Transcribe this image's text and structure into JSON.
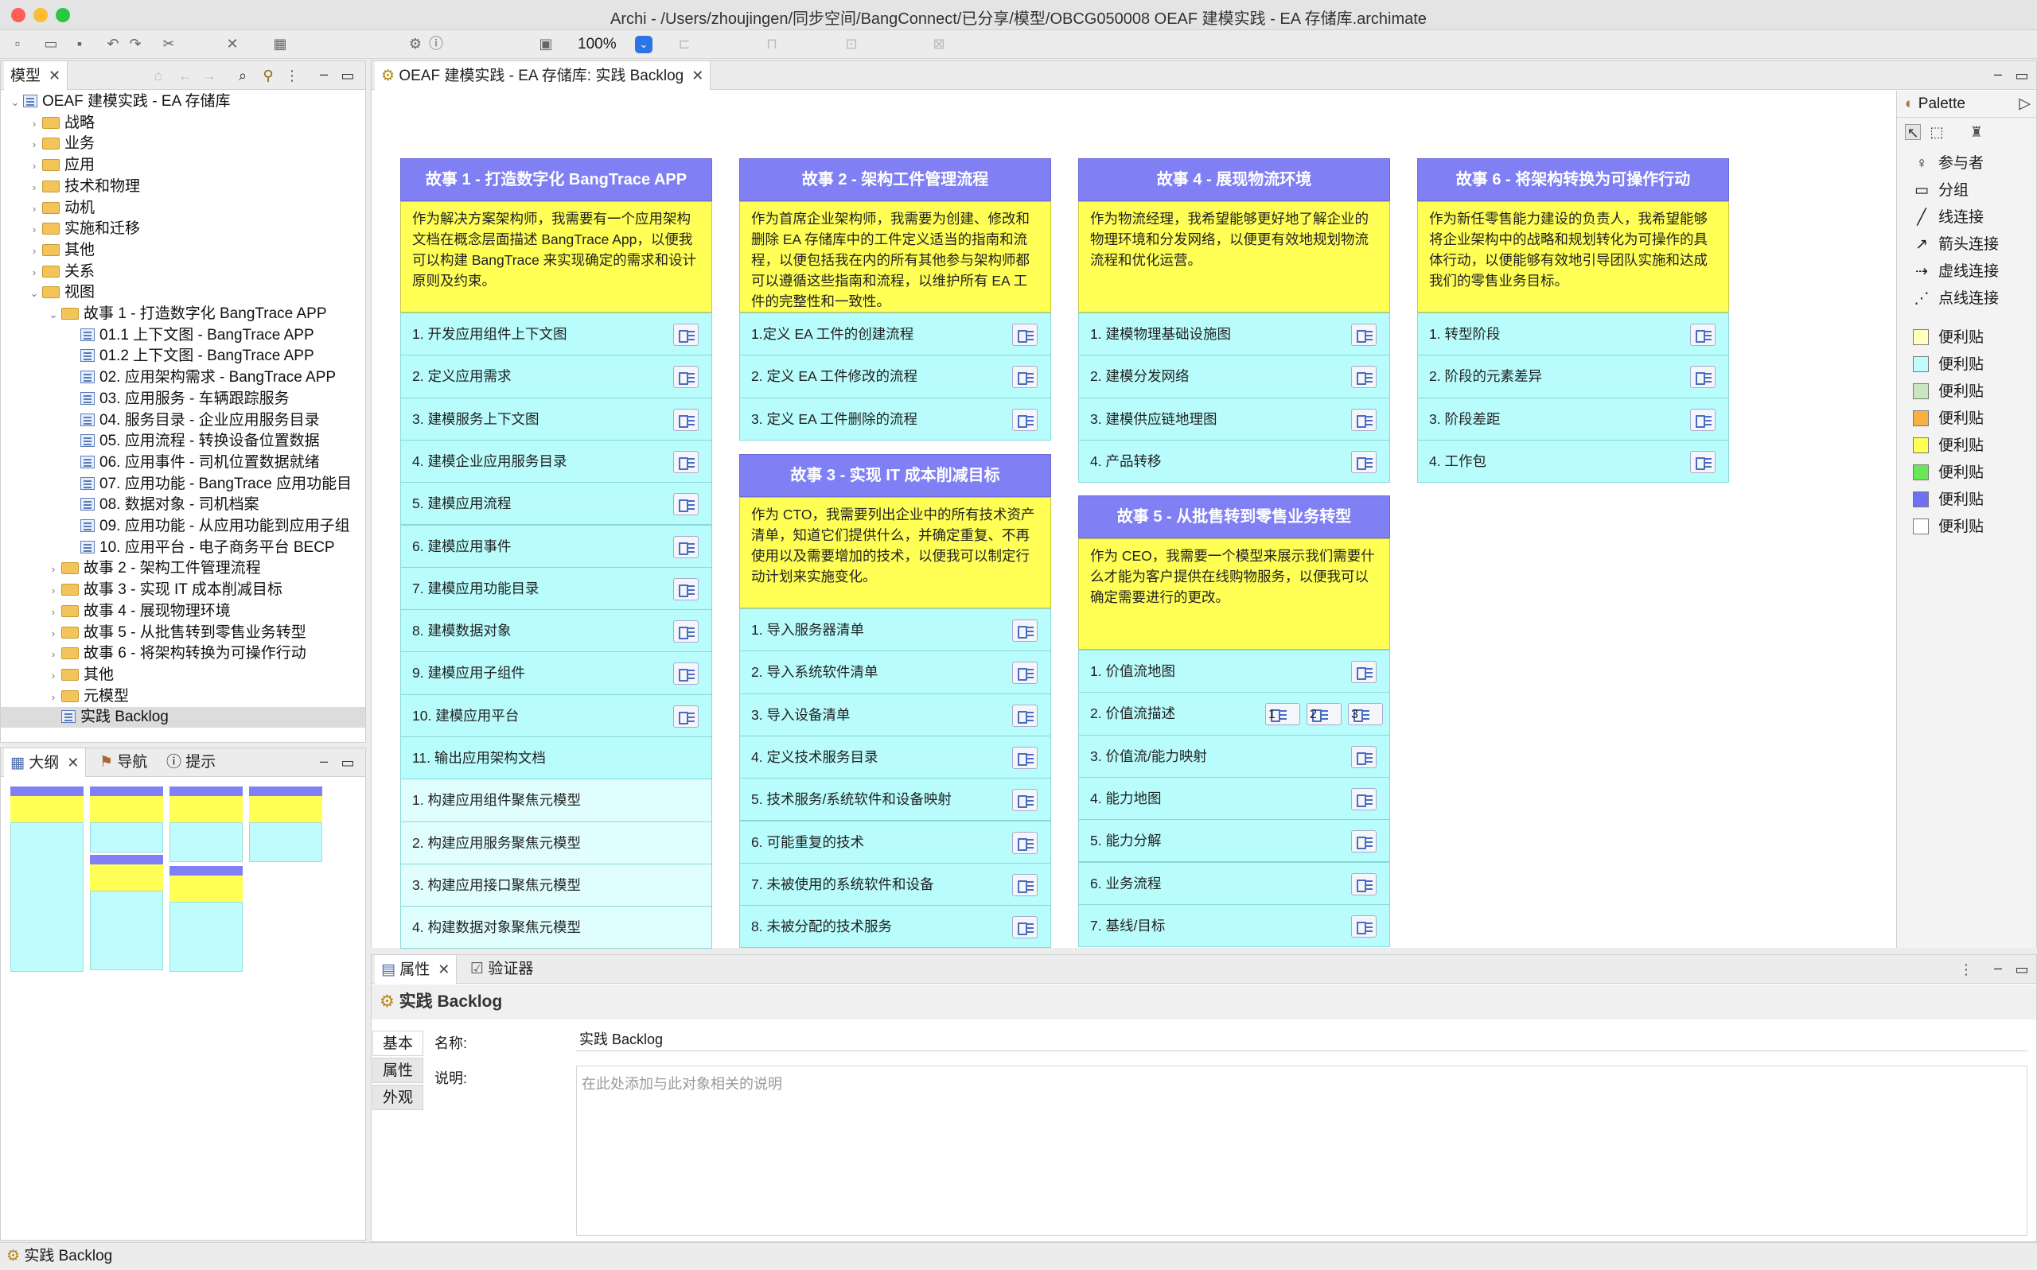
{
  "window": {
    "title": "Archi - /Users/zhoujingen/同步空间/BangConnect/已分享/模型/OBCG050008 OEAF 建模实践 - EA 存储库.archimate"
  },
  "toolbar": {
    "zoom": "100%"
  },
  "model_panel": {
    "tab": "模型",
    "tree": [
      {
        "label": "OEAF 建模实践 - EA 存储库",
        "level": 0,
        "type": "model",
        "expanded": true
      },
      {
        "label": "战略",
        "level": 1,
        "type": "folder"
      },
      {
        "label": "业务",
        "level": 1,
        "type": "folder"
      },
      {
        "label": "应用",
        "level": 1,
        "type": "folder"
      },
      {
        "label": "技术和物理",
        "level": 1,
        "type": "folder"
      },
      {
        "label": "动机",
        "level": 1,
        "type": "folder"
      },
      {
        "label": "实施和迁移",
        "level": 1,
        "type": "folder"
      },
      {
        "label": "其他",
        "level": 1,
        "type": "folder"
      },
      {
        "label": "关系",
        "level": 1,
        "type": "folder"
      },
      {
        "label": "视图",
        "level": 1,
        "type": "folder",
        "expanded": true
      },
      {
        "label": "故事 1 - 打造数字化 BangTrace APP",
        "level": 2,
        "type": "folder",
        "expanded": true
      },
      {
        "label": "01.1 上下文图 - BangTrace APP",
        "level": 3,
        "type": "view"
      },
      {
        "label": "01.2 上下文图 - BangTrace APP",
        "level": 3,
        "type": "view"
      },
      {
        "label": "02. 应用架构需求 - BangTrace APP",
        "level": 3,
        "type": "view"
      },
      {
        "label": "03. 应用服务 - 车辆跟踪服务",
        "level": 3,
        "type": "view"
      },
      {
        "label": "04. 服务目录 - 企业应用服务目录",
        "level": 3,
        "type": "view"
      },
      {
        "label": "05. 应用流程 - 转换设备位置数据",
        "level": 3,
        "type": "view"
      },
      {
        "label": "06. 应用事件 - 司机位置数据就绪",
        "level": 3,
        "type": "view"
      },
      {
        "label": "07. 应用功能 - BangTrace 应用功能目",
        "level": 3,
        "type": "view"
      },
      {
        "label": "08. 数据对象 - 司机档案",
        "level": 3,
        "type": "view"
      },
      {
        "label": "09. 应用功能 - 从应用功能到应用子组",
        "level": 3,
        "type": "view"
      },
      {
        "label": "10. 应用平台 - 电子商务平台 BECP",
        "level": 3,
        "type": "view"
      },
      {
        "label": "故事 2 - 架构工件管理流程",
        "level": 2,
        "type": "folder"
      },
      {
        "label": "故事 3 - 实现 IT 成本削减目标",
        "level": 2,
        "type": "folder"
      },
      {
        "label": "故事 4 - 展现物理环境",
        "level": 2,
        "type": "folder"
      },
      {
        "label": "故事 5 - 从批售转到零售业务转型",
        "level": 2,
        "type": "folder"
      },
      {
        "label": "故事 6 - 将架构转换为可操作行动",
        "level": 2,
        "type": "folder"
      },
      {
        "label": "其他",
        "level": 2,
        "type": "folder"
      },
      {
        "label": "元模型",
        "level": 2,
        "type": "folder"
      },
      {
        "label": "实践 Backlog",
        "level": 2,
        "type": "view",
        "selected": true
      }
    ]
  },
  "outline_panel": {
    "tabs": [
      "大纲",
      "导航",
      "提示"
    ]
  },
  "editor": {
    "tab": "OEAF 建模实践 - EA 存储库: 实践 Backlog",
    "stories": [
      {
        "title": "故事 1 - 打造数字化 BangTrace APP",
        "desc": "作为解决方案架构师，我需要有一个应用架构文档在概念层面描述 BangTrace App，以便我可以构建 BangTrace 来实现确定的需求和设计原则及约束。",
        "items": [
          {
            "label": "1. 开发应用组件上下文图",
            "link": true
          },
          {
            "label": "2. 定义应用需求",
            "link": true
          },
          {
            "label": "3. 建模服务上下文图",
            "link": true
          },
          {
            "label": "4. 建模企业应用服务目录",
            "link": true
          },
          {
            "label": "5. 建模应用流程",
            "link": true
          },
          {
            "label": "6. 建模应用事件",
            "link": true
          },
          {
            "label": "7. 建模应用功能目录",
            "link": true
          },
          {
            "label": "8. 建模数据对象",
            "link": true
          },
          {
            "label": "9. 建模应用子组件",
            "link": true
          },
          {
            "label": "10. 建模应用平台",
            "link": true
          },
          {
            "label": "11. 输出应用架构文档",
            "link": false
          },
          {
            "label": "1. 构建应用组件聚焦元模型",
            "link": false,
            "light": true
          },
          {
            "label": "2. 构建应用服务聚焦元模型",
            "link": false,
            "light": true
          },
          {
            "label": "3. 构建应用接口聚焦元模型",
            "link": false,
            "light": true
          },
          {
            "label": "4. 构建数据对象聚焦元模型",
            "link": false,
            "light": true
          }
        ]
      },
      {
        "title": "故事 2 - 架构工件管理流程",
        "desc": "作为首席企业架构师，我需要为创建、修改和删除 EA 存储库中的工件定义适当的指南和流程，以便包括我在内的所有其他参与架构师都可以遵循这些指南和流程，以维护所有 EA 工件的完整性和一致性。",
        "items": [
          {
            "label": "1.定义 EA 工件的创建流程",
            "link": true
          },
          {
            "label": "2. 定义 EA 工件修改的流程",
            "link": true
          },
          {
            "label": "3. 定义 EA 工件删除的流程",
            "link": true
          }
        ]
      },
      {
        "title": "故事 3 - 实现 IT 成本削减目标",
        "desc": "作为 CTO，我需要列出企业中的所有技术资产清单，知道它们提供什么，并确定重复、不再使用以及需要增加的技术，以便我可以制定行动计划来实施变化。",
        "items": [
          {
            "label": "1. 导入服务器清单",
            "link": true
          },
          {
            "label": "2. 导入系统软件清单",
            "link": true
          },
          {
            "label": "3. 导入设备清单",
            "link": true
          },
          {
            "label": "4. 定义技术服务目录",
            "link": true
          },
          {
            "label": "5. 技术服务/系统软件和设备映射",
            "link": true
          },
          {
            "label": "6. 可能重复的技术",
            "link": true
          },
          {
            "label": "7. 未被使用的系统软件和设备",
            "link": true
          },
          {
            "label": "8. 未被分配的技术服务",
            "link": true
          }
        ]
      },
      {
        "title": "故事 4 - 展现物流环境",
        "desc": "作为物流经理，我希望能够更好地了解企业的物理环境和分发网络，以便更有效地规划物流流程和优化运营。",
        "items": [
          {
            "label": "1. 建模物理基础设施图",
            "link": true
          },
          {
            "label": "2. 建模分发网络",
            "link": true
          },
          {
            "label": "3. 建模供应链地理图",
            "link": true
          },
          {
            "label": "4. 产品转移",
            "link": true
          }
        ]
      },
      {
        "title": "故事 5 - 从批售转到零售业务转型",
        "desc": "作为 CEO，我需要一个模型来展示我们需要什么才能为客户提供在线购物服务，以便我可以确定需要进行的更改。",
        "items": [
          {
            "label": "1. 价值流地图",
            "link": true
          },
          {
            "label": "2. 价值流描述",
            "link": true,
            "multi": [
              "1",
              "2",
              "3"
            ]
          },
          {
            "label": "3. 价值流/能力映射",
            "link": true
          },
          {
            "label": "4. 能力地图",
            "link": true
          },
          {
            "label": "5. 能力分解",
            "link": true
          },
          {
            "label": "6. 业务流程",
            "link": true
          },
          {
            "label": "7. 基线/目标",
            "link": true
          }
        ]
      },
      {
        "title": "故事 6 - 将架构转换为可操作行动",
        "desc": "作为新任零售能力建设的负责人，我希望能够将企业架构中的战略和规划转化为可操作的具体行动，以便能够有效地引导团队实施和达成我们的零售业务目标。",
        "items": [
          {
            "label": "1. 转型阶段",
            "link": true
          },
          {
            "label": "2. 阶段的元素差异",
            "link": true
          },
          {
            "label": "3. 阶段差距",
            "link": true
          },
          {
            "label": "4. 工作包",
            "link": true
          }
        ]
      }
    ]
  },
  "palette": {
    "title": "Palette",
    "tools": [
      "参与者",
      "分组",
      "线连接",
      "箭头连接",
      "虚线连接",
      "点线连接"
    ],
    "notes": [
      {
        "label": "便利贴",
        "color": "#ffffc0"
      },
      {
        "label": "便利贴",
        "color": "#c0fcfc"
      },
      {
        "label": "便利贴",
        "color": "#c8e6c0"
      },
      {
        "label": "便利贴",
        "color": "#f8b040"
      },
      {
        "label": "便利贴",
        "color": "#ffff55"
      },
      {
        "label": "便利贴",
        "color": "#68e858"
      },
      {
        "label": "便利贴",
        "color": "#7070f0"
      },
      {
        "label": "便利贴",
        "color": "#ffffff"
      }
    ]
  },
  "properties": {
    "tabs": [
      "属性",
      "验证器"
    ],
    "header": "实践 Backlog",
    "side_tabs": [
      "基本",
      "属性",
      "外观"
    ],
    "name_label": "名称:",
    "name_value": "实践 Backlog",
    "desc_label": "说明:",
    "desc_placeholder": "在此处添加与此对象相关的说明"
  },
  "status_bar": {
    "text": "实践 Backlog"
  }
}
